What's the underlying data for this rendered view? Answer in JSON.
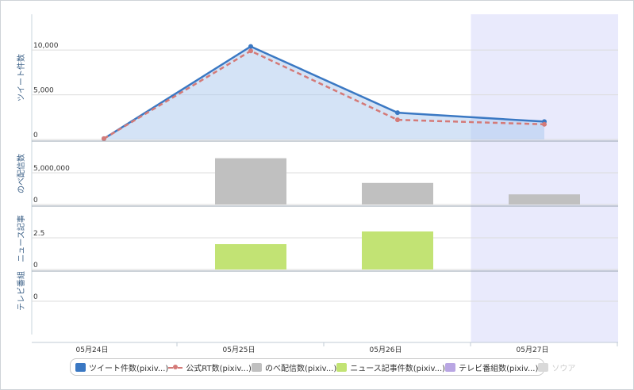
{
  "chart_data": {
    "type": "line",
    "categories": [
      "05月24日",
      "05月25日",
      "05月26日",
      "05月27日"
    ],
    "highlight_category": "05月27日",
    "panels": [
      {
        "ylabel": "ツイート件数",
        "yticks": [
          "0",
          "5,000",
          "10,000"
        ],
        "ylim": [
          0,
          14000
        ],
        "series": [
          {
            "name": "ツイート件数(pixiv...)",
            "type": "area",
            "color": "#3a78c3",
            "values": [
              100,
              10400,
              3000,
              2000
            ]
          },
          {
            "name": "公式RT数(pixiv...)",
            "type": "dashed-line",
            "color": "#d47a78",
            "values": [
              100,
              9900,
              2200,
              1700
            ]
          }
        ]
      },
      {
        "ylabel": "のべ配信数",
        "yticks": [
          "0",
          "5,000,000"
        ],
        "ylim": [
          0,
          10000000
        ],
        "series": [
          {
            "name": "のべ配信数(pixiv...)",
            "type": "bar",
            "color": "#c0c0c0",
            "values": [
              0,
              7300000,
              3400000,
              1600000
            ]
          }
        ]
      },
      {
        "ylabel": "ニュース記事",
        "yticks": [
          "0",
          "2.5"
        ],
        "ylim": [
          0,
          5
        ],
        "series": [
          {
            "name": "ニュース記事件数(pixiv...)",
            "type": "bar",
            "color": "#c2e374",
            "values": [
              0,
              2,
              3,
              0
            ]
          }
        ]
      },
      {
        "ylabel": "テレビ番組",
        "yticks": [
          "0"
        ],
        "ylim": [
          0,
          1
        ],
        "series": [
          {
            "name": "テレビ番組数(pixiv...)",
            "type": "bar",
            "color": "#b9a6e3",
            "values": [
              0,
              0,
              0,
              0
            ]
          }
        ]
      }
    ],
    "legend": [
      {
        "label": "ツイート件数(pixiv...)",
        "kind": "box",
        "color": "#3a78c3",
        "enabled": true
      },
      {
        "label": "公式RT数(pixiv...)",
        "kind": "line",
        "color": "#d47a78",
        "enabled": true
      },
      {
        "label": "のべ配信数(pixiv...)",
        "kind": "box",
        "color": "#c0c0c0",
        "enabled": true
      },
      {
        "label": "ニュース記事件数(pixiv...)",
        "kind": "box",
        "color": "#c2e374",
        "enabled": true
      },
      {
        "label": "テレビ番組数(pixiv...)",
        "kind": "box",
        "color": "#b9a6e3",
        "enabled": true
      },
      {
        "label": "ソウア",
        "kind": "box",
        "color": "#d9d9d9",
        "enabled": false
      }
    ],
    "legend_position": "bottom"
  }
}
